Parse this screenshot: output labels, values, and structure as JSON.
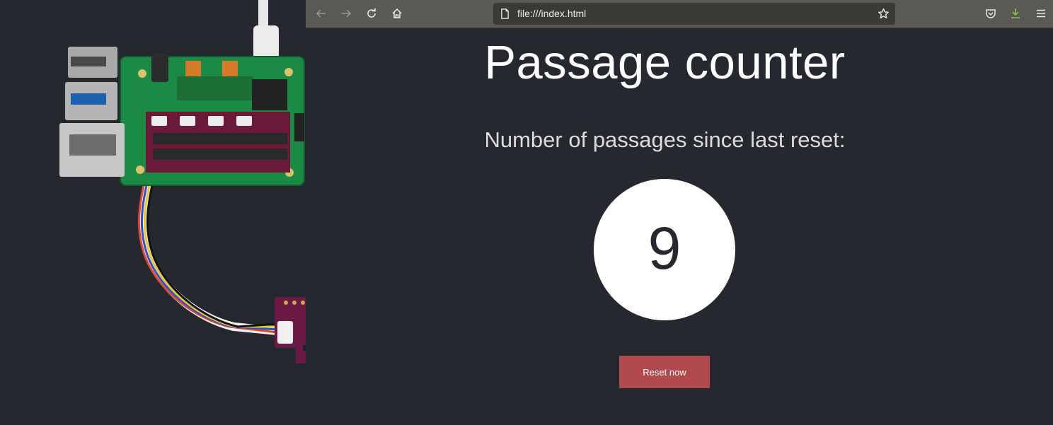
{
  "browser": {
    "url": "file:///index.html",
    "icons": {
      "back": "arrow-left-icon",
      "forward": "arrow-right-icon",
      "reload": "reload-icon",
      "home": "home-icon",
      "page": "page-icon",
      "bookmark": "star-icon",
      "pocket": "pocket-icon",
      "downloads": "download-icon",
      "menu": "hamburger-menu-icon"
    }
  },
  "page": {
    "title": "Passage counter",
    "subtitle": "Number of passages since last reset:",
    "count": "9",
    "reset_label": "Reset now"
  },
  "colors": {
    "background": "#262830",
    "toolbar": "#5b5954",
    "button": "#b04a4e",
    "counter_bg": "#ffffff"
  }
}
